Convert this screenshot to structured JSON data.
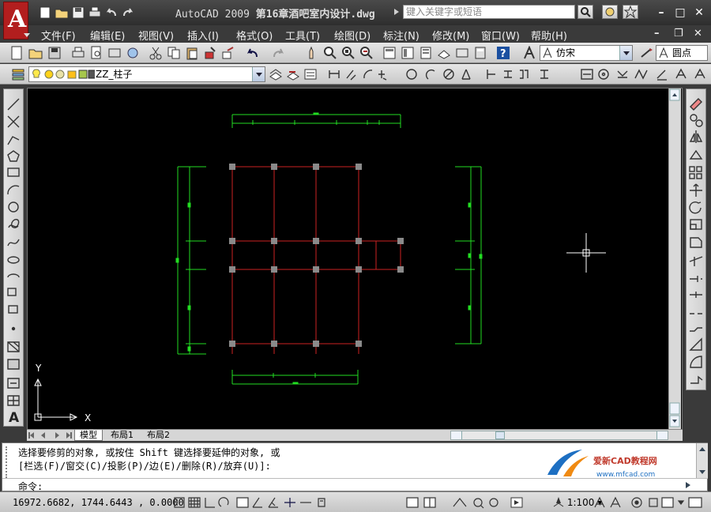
{
  "app": {
    "logo_letter": "A",
    "title_app": "AutoCAD 2009",
    "title_file": "第16章酒吧室内设计.dwg",
    "search_placeholder": "键入关键字或短语"
  },
  "menu": {
    "items": [
      "文件(F)",
      "编辑(E)",
      "视图(V)",
      "插入(I)",
      "格式(O)",
      "工具(T)",
      "绘图(D)",
      "标注(N)",
      "修改(M)",
      "窗口(W)",
      "帮助(H)"
    ]
  },
  "toolbar": {
    "text_style": "仿宋",
    "dim_style": "圆点",
    "layer": "ZZ_柱子"
  },
  "layout_tabs": [
    "模型",
    "布局1",
    "布局2"
  ],
  "ucs": {
    "x_label": "X",
    "y_label": "Y"
  },
  "command": {
    "line1": "选择要修剪的对象, 或按住 Shift 键选择要延伸的对象, 或",
    "line2": "[栏选(F)/窗交(C)/投影(P)/边(E)/删除(R)/放弃(U)]:",
    "prompt": "命令:"
  },
  "watermark": {
    "brand": "爱新CAD教程网",
    "url": "www.mfcad.com"
  },
  "status": {
    "coordinates": "16972.6682, 1744.6443 , 0.0000",
    "annotation_scale": "1:100"
  },
  "colors": {
    "canvas": "#000000",
    "grid_lines": "#cc2222",
    "dimensions": "#22dd22",
    "columns": "#8a8a8a",
    "crosshair": "#ffffff"
  }
}
